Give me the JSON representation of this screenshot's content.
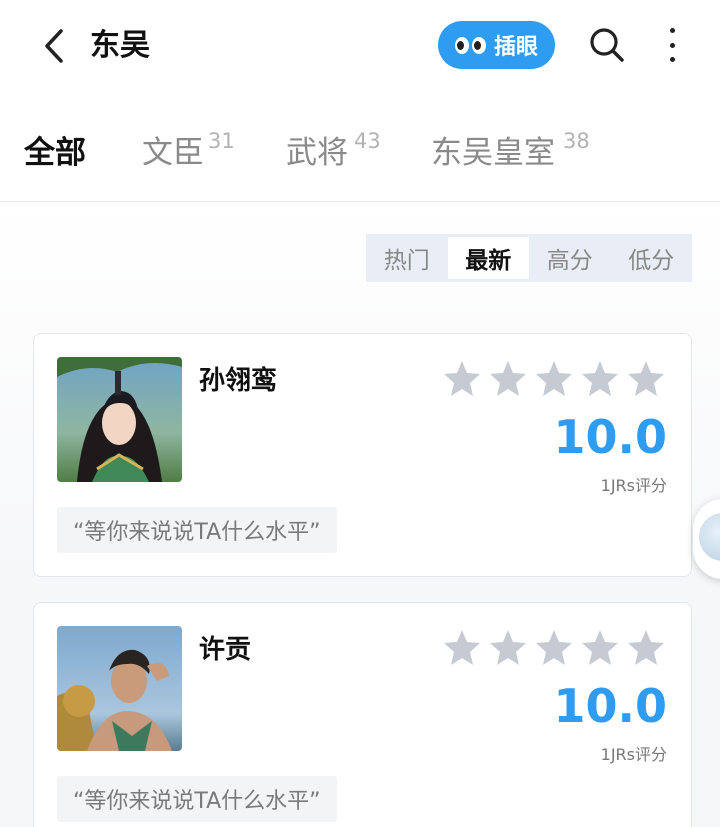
{
  "header": {
    "title": "东吴",
    "peek_label": "插眼"
  },
  "tabs": [
    {
      "label": "全部",
      "count": ""
    },
    {
      "label": "文臣",
      "count": "31"
    },
    {
      "label": "武将",
      "count": "43"
    },
    {
      "label": "东吴皇室",
      "count": "38"
    }
  ],
  "sort": [
    "热门",
    "最新",
    "高分",
    "低分"
  ],
  "sort_active": "最新",
  "cards": [
    {
      "name": "孙翎鸾",
      "score": "10.0",
      "rating_count": "1JRs评分",
      "comment_placeholder": "“等你来说说TA什么水平”",
      "stars": 5
    },
    {
      "name": "许贡",
      "score": "10.0",
      "rating_count": "1JRs评分",
      "comment_placeholder": "“等你来说说TA什么水平”",
      "stars": 5
    }
  ],
  "colors": {
    "accent": "#2e9cf0",
    "star_gray": "#c6cad3"
  },
  "icons": [
    "back-arrow-icon",
    "eyes-icon",
    "search-icon",
    "more-vertical-icon",
    "star-icon"
  ]
}
